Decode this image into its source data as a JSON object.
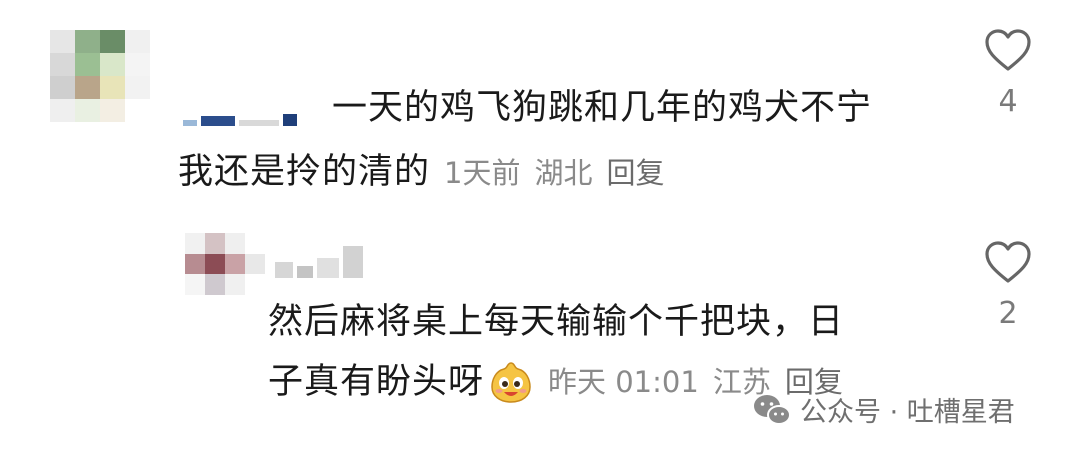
{
  "comments": [
    {
      "text_line1": "一天的鸡飞狗跳和几年的鸡犬不宁",
      "text_line2": "我还是拎的清的",
      "time": "1天前",
      "location": "湖北",
      "reply_label": "回复",
      "likes": "4",
      "avatar_pixels": [
        "#e6e6e6",
        "#8fb08a",
        "#6a8d67",
        "#f0f0f0",
        "#d8d8d8",
        "#9bbf93",
        "#d9e7c9",
        "#f4f4f4",
        "#cfcfcf",
        "#b9a58a",
        "#e8e4b8",
        "#f2f2f2",
        "#efefef",
        "#e9f0e2",
        "#f3eee3",
        "#ffffff"
      ]
    },
    {
      "text_line1": "然后麻将桌上每天输输个千把块，日",
      "text_line2": "子真有盼头呀",
      "time": "昨天 01:01",
      "location": "江苏",
      "reply_label": "回复",
      "likes": "2",
      "emoji": "smiling-face-emoji",
      "avatar_pixels": [
        "#f1f1f1",
        "#d4c2c4",
        "#efefef",
        "#ffffff",
        "#b78c91",
        "#8c4c55",
        "#c9a2a6",
        "#e8e8e8",
        "#f5f5f5",
        "#cfc9cf",
        "#f0f0f0",
        "#ffffff"
      ]
    }
  ],
  "watermark": {
    "text": "公众号 · 吐槽星君",
    "icon": "wechat-icon"
  },
  "icons": {
    "like": "heart-outline-icon"
  },
  "colors": {
    "text": "#1a1a1a",
    "meta": "#8a8a8a",
    "icon": "#666666"
  }
}
